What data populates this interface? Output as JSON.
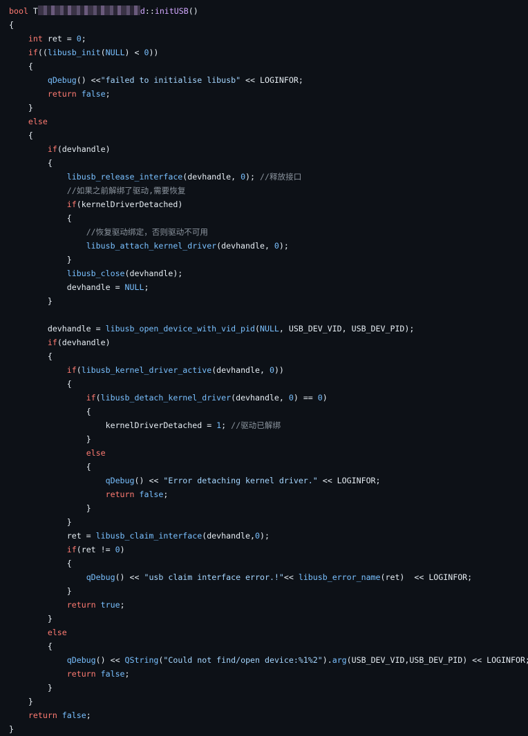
{
  "code_lines": [
    {
      "indent": 0,
      "tokens": [
        {
          "c": "kw",
          "t": "bool"
        },
        {
          "c": "plain",
          "t": " T"
        },
        {
          "c": "mask",
          "t": ""
        },
        {
          "c": "fn",
          "t": "d"
        },
        {
          "c": "plain",
          "t": "::"
        },
        {
          "c": "fn",
          "t": "initUSB"
        },
        {
          "c": "plain",
          "t": "()"
        }
      ]
    },
    {
      "indent": 0,
      "tokens": [
        {
          "c": "plain",
          "t": "{"
        }
      ]
    },
    {
      "indent": 1,
      "tokens": [
        {
          "c": "kw",
          "t": "int"
        },
        {
          "c": "plain",
          "t": " ret = "
        },
        {
          "c": "num",
          "t": "0"
        },
        {
          "c": "plain",
          "t": ";"
        }
      ]
    },
    {
      "indent": 1,
      "tokens": [
        {
          "c": "kw",
          "t": "if"
        },
        {
          "c": "plain",
          "t": "(("
        },
        {
          "c": "fnb",
          "t": "libusb_init"
        },
        {
          "c": "plain",
          "t": "("
        },
        {
          "c": "num",
          "t": "NULL"
        },
        {
          "c": "plain",
          "t": ") < "
        },
        {
          "c": "num",
          "t": "0"
        },
        {
          "c": "plain",
          "t": "))"
        }
      ]
    },
    {
      "indent": 1,
      "tokens": [
        {
          "c": "plain",
          "t": "{"
        }
      ]
    },
    {
      "indent": 2,
      "tokens": [
        {
          "c": "fnb",
          "t": "qDebug"
        },
        {
          "c": "plain",
          "t": "() <<"
        },
        {
          "c": "str",
          "t": "\"failed to initialise libusb\""
        },
        {
          "c": "plain",
          "t": " << LOGINFOR;"
        }
      ]
    },
    {
      "indent": 2,
      "tokens": [
        {
          "c": "kw",
          "t": "return"
        },
        {
          "c": "plain",
          "t": " "
        },
        {
          "c": "num",
          "t": "false"
        },
        {
          "c": "plain",
          "t": ";"
        }
      ]
    },
    {
      "indent": 1,
      "tokens": [
        {
          "c": "plain",
          "t": "}"
        }
      ]
    },
    {
      "indent": 1,
      "tokens": [
        {
          "c": "kw",
          "t": "else"
        }
      ]
    },
    {
      "indent": 1,
      "tokens": [
        {
          "c": "plain",
          "t": "{"
        }
      ]
    },
    {
      "indent": 2,
      "tokens": [
        {
          "c": "kw",
          "t": "if"
        },
        {
          "c": "plain",
          "t": "(devhandle)"
        }
      ]
    },
    {
      "indent": 2,
      "tokens": [
        {
          "c": "plain",
          "t": "{"
        }
      ]
    },
    {
      "indent": 3,
      "tokens": [
        {
          "c": "fnb",
          "t": "libusb_release_interface"
        },
        {
          "c": "plain",
          "t": "(devhandle, "
        },
        {
          "c": "num",
          "t": "0"
        },
        {
          "c": "plain",
          "t": "); "
        },
        {
          "c": "cmt",
          "t": "//释放接口"
        }
      ]
    },
    {
      "indent": 3,
      "tokens": [
        {
          "c": "cmt",
          "t": "//如果之前解绑了驱动,需要恢复"
        }
      ]
    },
    {
      "indent": 3,
      "tokens": [
        {
          "c": "kw",
          "t": "if"
        },
        {
          "c": "plain",
          "t": "(kernelDriverDetached)"
        }
      ]
    },
    {
      "indent": 3,
      "tokens": [
        {
          "c": "plain",
          "t": "{"
        }
      ]
    },
    {
      "indent": 4,
      "tokens": [
        {
          "c": "cmt",
          "t": "//恢复驱动绑定，否则驱动不可用"
        }
      ]
    },
    {
      "indent": 4,
      "tokens": [
        {
          "c": "fnb",
          "t": "libusb_attach_kernel_driver"
        },
        {
          "c": "plain",
          "t": "(devhandle, "
        },
        {
          "c": "num",
          "t": "0"
        },
        {
          "c": "plain",
          "t": ");"
        }
      ]
    },
    {
      "indent": 3,
      "tokens": [
        {
          "c": "plain",
          "t": "}"
        }
      ]
    },
    {
      "indent": 3,
      "tokens": [
        {
          "c": "fnb",
          "t": "libusb_close"
        },
        {
          "c": "plain",
          "t": "(devhandle);"
        }
      ]
    },
    {
      "indent": 3,
      "tokens": [
        {
          "c": "plain",
          "t": "devhandle = "
        },
        {
          "c": "num",
          "t": "NULL"
        },
        {
          "c": "plain",
          "t": ";"
        }
      ]
    },
    {
      "indent": 2,
      "tokens": [
        {
          "c": "plain",
          "t": "}"
        }
      ]
    },
    {
      "indent": 0,
      "tokens": []
    },
    {
      "indent": 2,
      "tokens": [
        {
          "c": "plain",
          "t": "devhandle = "
        },
        {
          "c": "fnb",
          "t": "libusb_open_device_with_vid_pid"
        },
        {
          "c": "plain",
          "t": "("
        },
        {
          "c": "num",
          "t": "NULL"
        },
        {
          "c": "plain",
          "t": ", USB_DEV_VID, USB_DEV_PID);"
        }
      ]
    },
    {
      "indent": 2,
      "tokens": [
        {
          "c": "kw",
          "t": "if"
        },
        {
          "c": "plain",
          "t": "(devhandle)"
        }
      ]
    },
    {
      "indent": 2,
      "tokens": [
        {
          "c": "plain",
          "t": "{"
        }
      ]
    },
    {
      "indent": 3,
      "tokens": [
        {
          "c": "kw",
          "t": "if"
        },
        {
          "c": "plain",
          "t": "("
        },
        {
          "c": "fnb",
          "t": "libusb_kernel_driver_active"
        },
        {
          "c": "plain",
          "t": "(devhandle, "
        },
        {
          "c": "num",
          "t": "0"
        },
        {
          "c": "plain",
          "t": "))"
        }
      ]
    },
    {
      "indent": 3,
      "tokens": [
        {
          "c": "plain",
          "t": "{"
        }
      ]
    },
    {
      "indent": 4,
      "tokens": [
        {
          "c": "kw",
          "t": "if"
        },
        {
          "c": "plain",
          "t": "("
        },
        {
          "c": "fnb",
          "t": "libusb_detach_kernel_driver"
        },
        {
          "c": "plain",
          "t": "(devhandle, "
        },
        {
          "c": "num",
          "t": "0"
        },
        {
          "c": "plain",
          "t": ") == "
        },
        {
          "c": "num",
          "t": "0"
        },
        {
          "c": "plain",
          "t": ")"
        }
      ]
    },
    {
      "indent": 4,
      "tokens": [
        {
          "c": "plain",
          "t": "{"
        }
      ]
    },
    {
      "indent": 5,
      "tokens": [
        {
          "c": "plain",
          "t": "kernelDriverDetached = "
        },
        {
          "c": "num",
          "t": "1"
        },
        {
          "c": "plain",
          "t": "; "
        },
        {
          "c": "cmt",
          "t": "//驱动已解绑"
        }
      ]
    },
    {
      "indent": 4,
      "tokens": [
        {
          "c": "plain",
          "t": "}"
        }
      ]
    },
    {
      "indent": 4,
      "tokens": [
        {
          "c": "kw",
          "t": "else"
        }
      ]
    },
    {
      "indent": 4,
      "tokens": [
        {
          "c": "plain",
          "t": "{"
        }
      ]
    },
    {
      "indent": 5,
      "tokens": [
        {
          "c": "fnb",
          "t": "qDebug"
        },
        {
          "c": "plain",
          "t": "() << "
        },
        {
          "c": "str",
          "t": "\"Error detaching kernel driver.\""
        },
        {
          "c": "plain",
          "t": " << LOGINFOR;"
        }
      ]
    },
    {
      "indent": 5,
      "tokens": [
        {
          "c": "kw",
          "t": "return"
        },
        {
          "c": "plain",
          "t": " "
        },
        {
          "c": "num",
          "t": "false"
        },
        {
          "c": "plain",
          "t": ";"
        }
      ]
    },
    {
      "indent": 4,
      "tokens": [
        {
          "c": "plain",
          "t": "}"
        }
      ]
    },
    {
      "indent": 3,
      "tokens": [
        {
          "c": "plain",
          "t": "}"
        }
      ]
    },
    {
      "indent": 3,
      "tokens": [
        {
          "c": "plain",
          "t": "ret = "
        },
        {
          "c": "fnb",
          "t": "libusb_claim_interface"
        },
        {
          "c": "plain",
          "t": "(devhandle,"
        },
        {
          "c": "num",
          "t": "0"
        },
        {
          "c": "plain",
          "t": ");"
        }
      ]
    },
    {
      "indent": 3,
      "tokens": [
        {
          "c": "kw",
          "t": "if"
        },
        {
          "c": "plain",
          "t": "(ret != "
        },
        {
          "c": "num",
          "t": "0"
        },
        {
          "c": "plain",
          "t": ")"
        }
      ]
    },
    {
      "indent": 3,
      "tokens": [
        {
          "c": "plain",
          "t": "{"
        }
      ]
    },
    {
      "indent": 4,
      "tokens": [
        {
          "c": "fnb",
          "t": "qDebug"
        },
        {
          "c": "plain",
          "t": "() << "
        },
        {
          "c": "str",
          "t": "\"usb claim interface error.!\""
        },
        {
          "c": "plain",
          "t": "<< "
        },
        {
          "c": "fnb",
          "t": "libusb_error_name"
        },
        {
          "c": "plain",
          "t": "(ret)  << LOGINFOR;"
        }
      ]
    },
    {
      "indent": 3,
      "tokens": [
        {
          "c": "plain",
          "t": "}"
        }
      ]
    },
    {
      "indent": 3,
      "tokens": [
        {
          "c": "kw",
          "t": "return"
        },
        {
          "c": "plain",
          "t": " "
        },
        {
          "c": "num",
          "t": "true"
        },
        {
          "c": "plain",
          "t": ";"
        }
      ]
    },
    {
      "indent": 2,
      "tokens": [
        {
          "c": "plain",
          "t": "}"
        }
      ]
    },
    {
      "indent": 2,
      "tokens": [
        {
          "c": "kw",
          "t": "else"
        }
      ]
    },
    {
      "indent": 2,
      "tokens": [
        {
          "c": "plain",
          "t": "{"
        }
      ]
    },
    {
      "indent": 3,
      "tokens": [
        {
          "c": "fnb",
          "t": "qDebug"
        },
        {
          "c": "plain",
          "t": "() << "
        },
        {
          "c": "fnb",
          "t": "QString"
        },
        {
          "c": "plain",
          "t": "("
        },
        {
          "c": "str",
          "t": "\"Could not find/open device:%1%2\""
        },
        {
          "c": "plain",
          "t": ")."
        },
        {
          "c": "fnb",
          "t": "arg"
        },
        {
          "c": "plain",
          "t": "(USB_DEV_VID,USB_DEV_PID) << LOGINFOR;"
        }
      ]
    },
    {
      "indent": 3,
      "tokens": [
        {
          "c": "kw",
          "t": "return"
        },
        {
          "c": "plain",
          "t": " "
        },
        {
          "c": "num",
          "t": "false"
        },
        {
          "c": "plain",
          "t": ";"
        }
      ]
    },
    {
      "indent": 2,
      "tokens": [
        {
          "c": "plain",
          "t": "}"
        }
      ]
    },
    {
      "indent": 1,
      "tokens": [
        {
          "c": "plain",
          "t": "}"
        }
      ]
    },
    {
      "indent": 1,
      "tokens": [
        {
          "c": "kw",
          "t": "return"
        },
        {
          "c": "plain",
          "t": " "
        },
        {
          "c": "num",
          "t": "false"
        },
        {
          "c": "plain",
          "t": ";"
        }
      ]
    },
    {
      "indent": 0,
      "tokens": [
        {
          "c": "plain",
          "t": "}"
        }
      ]
    }
  ]
}
